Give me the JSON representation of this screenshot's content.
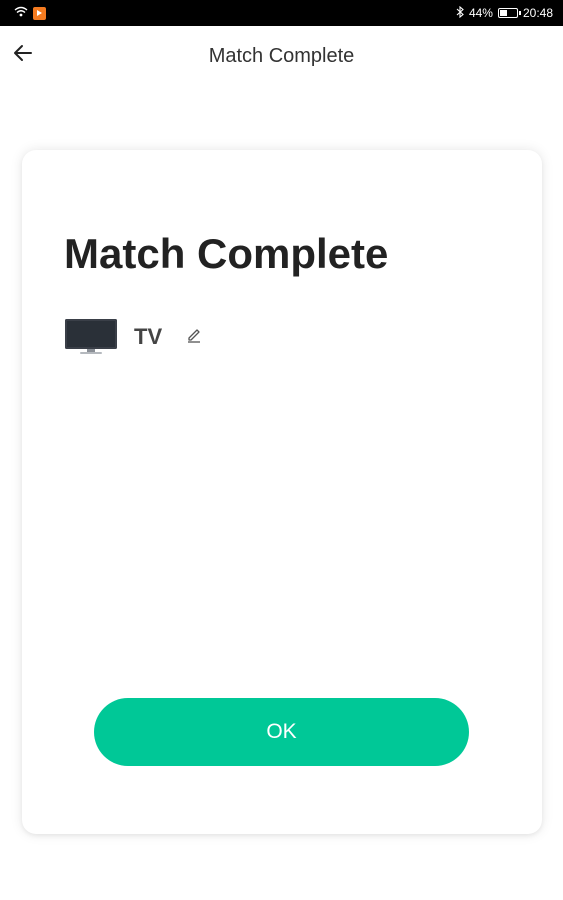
{
  "status_bar": {
    "battery": "44%",
    "time": "20:48",
    "icons": [
      "wifi-icon",
      "app-notification-icon",
      "bluetooth-icon",
      "battery-icon"
    ]
  },
  "header": {
    "title": "Match Complete",
    "back_icon": "arrow-left-icon"
  },
  "card": {
    "title": "Match Complete",
    "device": {
      "name": "TV",
      "icon": "tv-icon",
      "edit_icon": "pencil-icon"
    },
    "ok_label": "OK"
  },
  "colors": {
    "accent": "#00c897",
    "status_bar_bg": "#000000",
    "notification_icon": "#f47b20"
  }
}
